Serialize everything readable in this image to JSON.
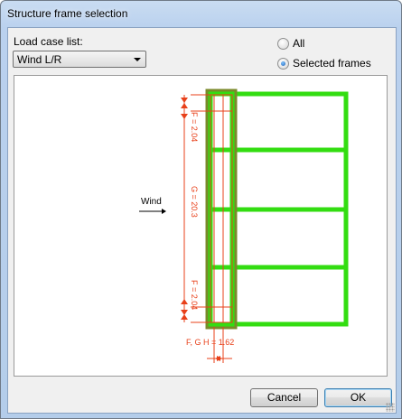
{
  "window": {
    "title": "Structure frame selection"
  },
  "load_case": {
    "label": "Load case list:",
    "selected": "Wind L/R"
  },
  "radios": [
    {
      "label": "All",
      "checked": false
    },
    {
      "label": "Selected frames",
      "checked": true
    }
  ],
  "drawing": {
    "wind_label": "Wind",
    "dim_top": "F = 2.04",
    "dim_middle": "G = 20.3",
    "dim_bottom": "F = 2.04",
    "dim_bottom_width": "F, G H = 1.62"
  },
  "buttons": {
    "cancel": "Cancel",
    "ok": "OK"
  },
  "colors": {
    "frame": "#33dd11",
    "selected_frame": "#7a8a2a",
    "dimension": "#e8401a"
  }
}
